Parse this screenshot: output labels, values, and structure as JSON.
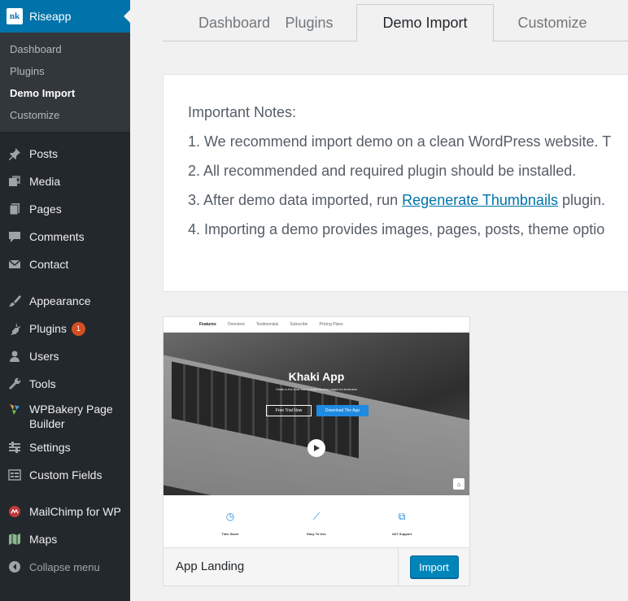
{
  "brand": {
    "logo_text": "nk",
    "name": "Riseapp"
  },
  "submenu": [
    {
      "label": "Dashboard",
      "current": false
    },
    {
      "label": "Plugins",
      "current": false
    },
    {
      "label": "Demo Import",
      "current": true
    },
    {
      "label": "Customize",
      "current": false
    }
  ],
  "menu": {
    "posts": "Posts",
    "media": "Media",
    "pages": "Pages",
    "comments": "Comments",
    "contact": "Contact",
    "appearance": "Appearance",
    "plugins": "Plugins",
    "plugins_badge": "1",
    "users": "Users",
    "tools": "Tools",
    "wpbakery_line1": "WPBakery Page",
    "wpbakery_line2": "Builder",
    "settings": "Settings",
    "custom_fields": "Custom Fields",
    "mailchimp": "MailChimp for WP",
    "maps": "Maps",
    "collapse": "Collapse menu"
  },
  "tabs": [
    {
      "label": "Dashboard",
      "active": false
    },
    {
      "label": "Plugins",
      "active": false
    },
    {
      "label": "Demo Import",
      "active": true
    },
    {
      "label": "Customize",
      "active": false
    }
  ],
  "notes": {
    "title": "Important Notes:",
    "items": [
      "1. We recommend import demo on a clean WordPress website. T",
      "2. All recommended and required plugin should be installed.",
      "4. Importing a demo provides images, pages, posts, theme optio"
    ],
    "item3_prefix": "3. After demo data imported, run ",
    "item3_link": "Regenerate Thumbnails",
    "item3_suffix": " plugin."
  },
  "demo": {
    "name": "App Landing",
    "import_label": "Import",
    "preview": {
      "nav": [
        "Features",
        "Overview",
        "Testimonials",
        "Subscribe",
        "Pricing Plans"
      ],
      "title": "Khaki App",
      "subtitle": "Khaki is the best tool to build landing pages for business",
      "btn_free": "Free Trial Now",
      "btn_download": "Download The App",
      "features": [
        "Time Saver",
        "Easy To Use",
        "24/7 Support"
      ]
    }
  },
  "colors": {
    "sidebar": "#23282d",
    "accent": "#0073aa",
    "button": "#0085ba",
    "badge": "#d54e21"
  }
}
